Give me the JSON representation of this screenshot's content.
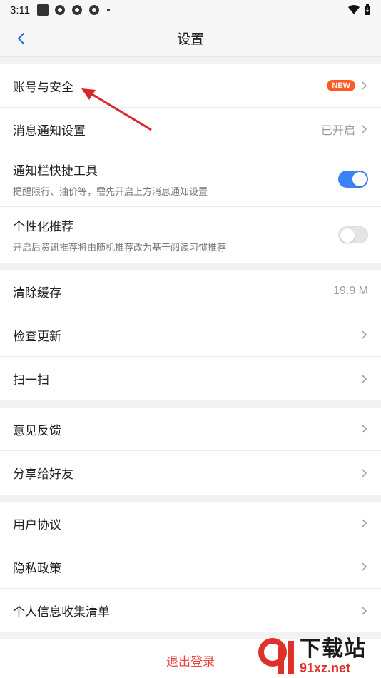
{
  "status_bar": {
    "time": "3:11"
  },
  "nav": {
    "title": "设置"
  },
  "groups": {
    "g1": {
      "account": {
        "label": "账号与安全",
        "badge": "NEW"
      },
      "notify": {
        "label": "消息通知设置",
        "value": "已开启"
      },
      "shortcut": {
        "label": "通知栏快捷工具",
        "sub": "提醒限行、油价等，需先开启上方消息通知设置",
        "toggle": "on"
      },
      "personal": {
        "label": "个性化推荐",
        "sub": "开启后资讯推荐将由随机推荐改为基于阅读习惯推荐",
        "toggle": "off"
      }
    },
    "g2": {
      "cache": {
        "label": "清除缓存",
        "value": "19.9 M"
      },
      "update": {
        "label": "检查更新"
      },
      "scan": {
        "label": "扫一扫"
      }
    },
    "g3": {
      "feedback": {
        "label": "意见反馈"
      },
      "share": {
        "label": "分享给好友"
      }
    },
    "g4": {
      "agreement": {
        "label": "用户协议"
      },
      "privacy": {
        "label": "隐私政策"
      },
      "info": {
        "label": "个人信息收集清单"
      }
    }
  },
  "logout": {
    "label": "退出登录"
  },
  "watermark": {
    "brand": "下载站",
    "url": "91xz.net"
  },
  "colors": {
    "accent": "#3b82f6",
    "badge": "#ff5a1f",
    "danger": "#e84545",
    "arrow": "#d8262a"
  }
}
